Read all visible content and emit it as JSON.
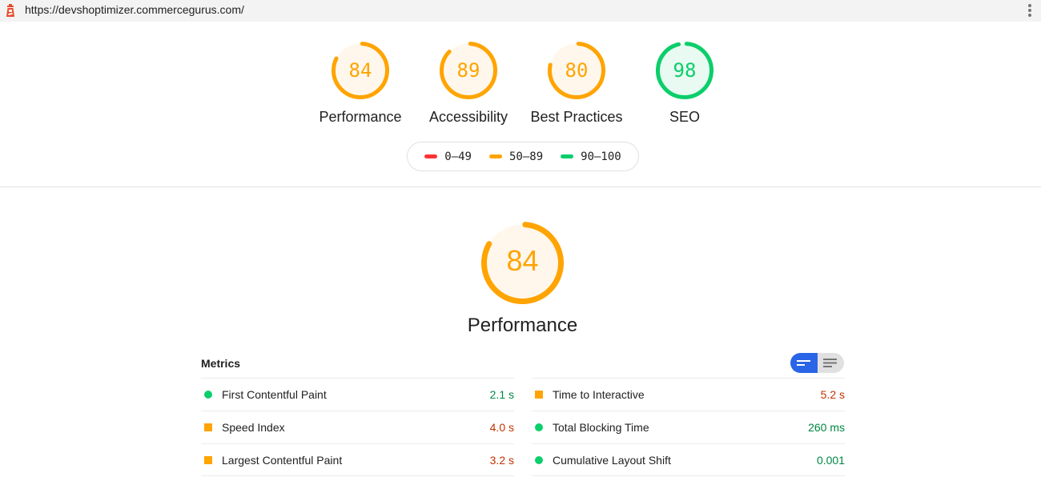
{
  "browser": {
    "url": "https://devshoptimizer.commercegurus.com/",
    "logo_icon": "lighthouse-icon",
    "menu_icon": "more-vertical-icon"
  },
  "colors": {
    "fail": "#ff3333",
    "average": "#ffa400",
    "average_text": "#c33300",
    "average_fill": "#fff7ec",
    "pass": "#0cce6b",
    "pass_text": "#018642",
    "pass_fill": "#e8faf1",
    "toggle_active": "#2a65e8"
  },
  "categories": [
    {
      "label": "Performance",
      "score": 84,
      "rating": "average"
    },
    {
      "label": "Accessibility",
      "score": 89,
      "rating": "average"
    },
    {
      "label": "Best Practices",
      "score": 80,
      "rating": "average"
    },
    {
      "label": "SEO",
      "score": 98,
      "rating": "pass"
    }
  ],
  "legend": [
    {
      "range": "0–49",
      "rating": "fail"
    },
    {
      "range": "50–89",
      "rating": "average"
    },
    {
      "range": "90–100",
      "rating": "pass"
    }
  ],
  "performance": {
    "label": "Performance",
    "score": 84,
    "rating": "average"
  },
  "metrics": {
    "title": "Metrics",
    "toggle": {
      "options": [
        {
          "name": "summary-view",
          "active": true
        },
        {
          "name": "expanded-view",
          "active": false
        }
      ]
    },
    "left": [
      {
        "name": "First Contentful Paint",
        "value": "2.1 s",
        "rating": "pass"
      },
      {
        "name": "Speed Index",
        "value": "4.0 s",
        "rating": "average"
      },
      {
        "name": "Largest Contentful Paint",
        "value": "3.2 s",
        "rating": "average"
      }
    ],
    "right": [
      {
        "name": "Time to Interactive",
        "value": "5.2 s",
        "rating": "average"
      },
      {
        "name": "Total Blocking Time",
        "value": "260 ms",
        "rating": "pass"
      },
      {
        "name": "Cumulative Layout Shift",
        "value": "0.001",
        "rating": "pass"
      }
    ]
  }
}
